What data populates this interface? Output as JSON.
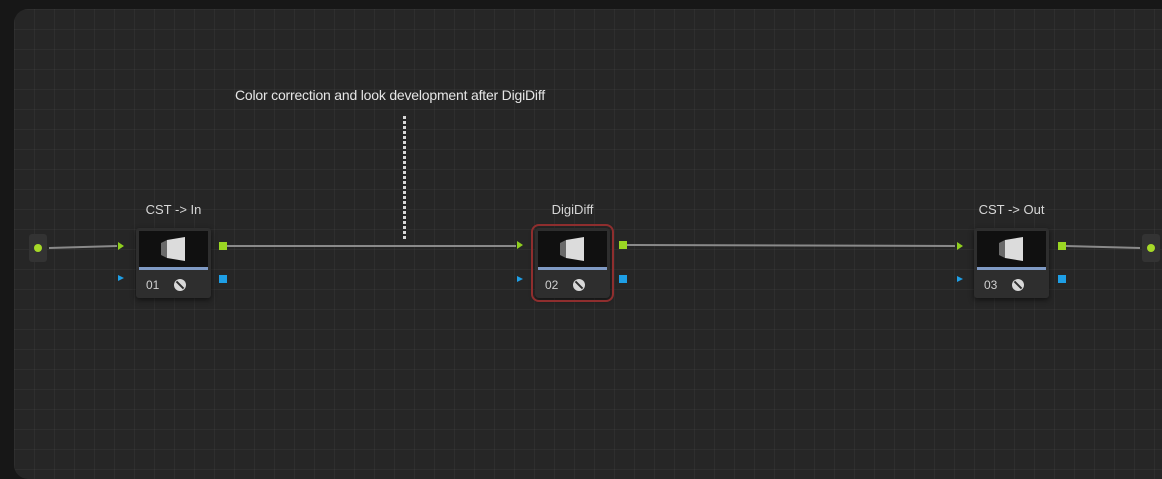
{
  "note": {
    "text": "Color correction and look development after DigiDiff"
  },
  "nodes": [
    {
      "label": "CST -> In",
      "number": "01",
      "icon": "lamp-icon",
      "selected": false
    },
    {
      "label": "DigiDiff",
      "number": "02",
      "icon": "lamp-icon",
      "selected": true
    },
    {
      "label": "CST -> Out",
      "number": "03",
      "icon": "lamp-icon",
      "selected": false
    }
  ],
  "colors": {
    "canvas_bg": "#262626",
    "wire": "#8a8a8a",
    "rgb_port": "#9ad623",
    "alpha_port": "#1e9fe6",
    "selection": "#8f2e2e",
    "thumbnail_bar": "#7f9ac4"
  }
}
